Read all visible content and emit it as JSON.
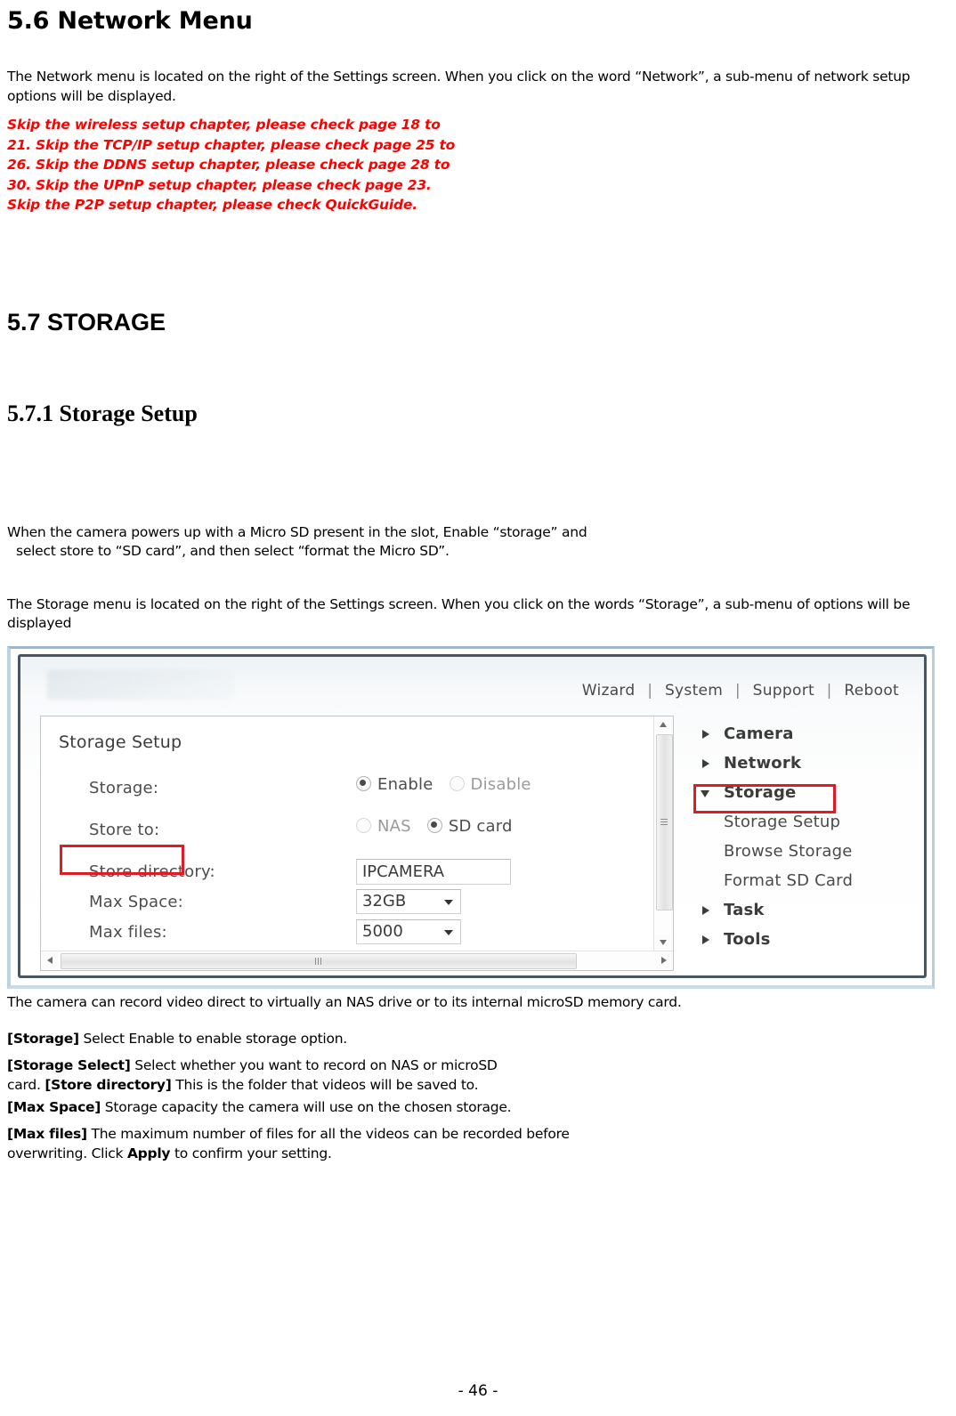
{
  "document": {
    "section_network": {
      "heading": "5.6 Network Menu",
      "intro": "The Network menu is located on the right of the Settings screen. When you click on the word “Network”, a sub-menu of network setup options will be displayed.",
      "notice_lines": [
        "Skip the wireless setup chapter, please check page 18 to",
        "21. Skip the TCP/IP setup chapter, please check page 25 to",
        "26. Skip the DDNS setup chapter, please check page 28 to",
        "30. Skip the UPnP setup chapter, please check page 23.",
        "Skip the P2P setup chapter, please check QuickGuide."
      ],
      "notice_color": "#FF0000"
    },
    "section_storage": {
      "heading": "5.7 STORAGE",
      "subheading": "5.7.1 Storage Setup",
      "para1_line1": "When the camera powers up with a Micro SD present in the slot, Enable “storage” and",
      "para1_line2": "select store to “SD card”, and then select “format the Micro SD”.",
      "para2": "The Storage menu is located on the right of the Settings screen. When you click on the words “Storage”, a sub-menu of options will be displayed",
      "para3": "The camera can record video direct to virtually an NAS drive or to its internal microSD memory card.",
      "definitions": [
        {
          "term": "[Storage]",
          "text": " Select Enable to enable storage option."
        },
        {
          "term": "[Storage Select]",
          "text": " Select whether you want to record on NAS or microSD"
        },
        {
          "term": "[Store directory]",
          "text": " This is the folder that videos will be saved to.",
          "prefix": "card. "
        },
        {
          "term": "[Max Space]",
          "text": " Storage capacity the camera will use on the chosen storage."
        },
        {
          "term": "[Max files]",
          "text": " The maximum number of files for all the videos can be recorded before"
        }
      ],
      "closing_prefix": "overwriting. Click ",
      "closing_bold": "Apply",
      "closing_suffix": " to confirm your setting."
    },
    "footer": "- 46 -"
  },
  "screenshot": {
    "topnav": {
      "items": [
        "Wizard",
        "System",
        "Support",
        "Reboot"
      ],
      "separator": "|"
    },
    "panel": {
      "title": "Storage Setup",
      "rows": {
        "storage": {
          "label": "Storage:",
          "options": [
            "Enable",
            "Disable"
          ],
          "selected": "Enable"
        },
        "store_to": {
          "label": "Store to:",
          "options": [
            "NAS",
            "SD card"
          ],
          "selected": "SD card"
        },
        "store_directory": {
          "label": "Store directory:",
          "value": "IPCAMERA"
        },
        "max_space": {
          "label": "Max Space:",
          "value": "32GB"
        },
        "max_files": {
          "label": "Max files:",
          "value": "5000"
        }
      }
    },
    "menu_tree": [
      {
        "label": "Camera",
        "type": "branch",
        "expanded": false
      },
      {
        "label": "Network",
        "type": "branch",
        "expanded": false
      },
      {
        "label": "Storage",
        "type": "branch",
        "expanded": true
      },
      {
        "label": "Storage Setup",
        "type": "leaf",
        "highlighted": true
      },
      {
        "label": "Browse Storage",
        "type": "leaf",
        "highlighted": false
      },
      {
        "label": "Format SD Card",
        "type": "leaf",
        "highlighted": false
      },
      {
        "label": "Task",
        "type": "branch",
        "expanded": false
      },
      {
        "label": "Tools",
        "type": "branch",
        "expanded": false
      }
    ],
    "highlight_color": "#e01b24"
  }
}
